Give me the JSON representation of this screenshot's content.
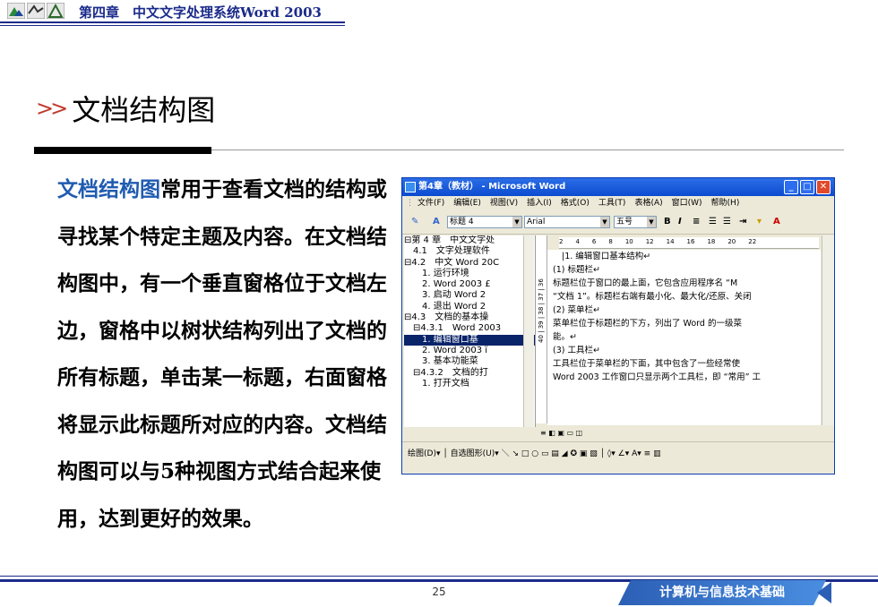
{
  "header": {
    "chapter": "第四章　中文文字处理系统Word 2003"
  },
  "slide": {
    "title": "文档结构图",
    "body_highlight": "文档结构图",
    "body_rest": "常用于查看文档的结构或寻找某个特定主题及内容。在文档结构图中，有一个垂直窗格位于文档左边，窗格中以树状结构列出了文档的所有标题，单击某一标题，右面窗格将显示此标题所对应的内容。文档结构图可以与5种视图方式结合起来使用，达到更好的效果。"
  },
  "window": {
    "title": "第4章（教材） - Microsoft Word",
    "menu": [
      "文件(F)",
      "编辑(E)",
      "视图(V)",
      "插入(I)",
      "格式(O)",
      "工具(T)",
      "表格(A)",
      "窗口(W)",
      "帮助(H)"
    ],
    "style_combo": "标题 4",
    "font_combo": "Arial",
    "size_combo": "五号",
    "map_items": [
      {
        "text": "⊟第 4 章　中文文字处",
        "selected": false
      },
      {
        "text": "　4.1　文字处理软件",
        "selected": false
      },
      {
        "text": "⊟4.2　中文 Word 20C",
        "selected": false
      },
      {
        "text": "　　1. 运行环境",
        "selected": false
      },
      {
        "text": "　　2. Word 2003 £",
        "selected": false
      },
      {
        "text": "　　3. 启动 Word 2",
        "selected": false
      },
      {
        "text": "　　4. 退出 Word 2",
        "selected": false
      },
      {
        "text": "⊟4.3　文档的基本操",
        "selected": false
      },
      {
        "text": "　⊟4.3.1　Word 2003",
        "selected": false
      },
      {
        "text": "　　1. 编辑窗口基",
        "selected": true
      },
      {
        "text": "　　2. Word 2003 ï",
        "selected": false
      },
      {
        "text": "　　3. 基本功能菜",
        "selected": false
      },
      {
        "text": "　⊟4.3.2　文档的打",
        "selected": false
      },
      {
        "text": "　　1. 打开文档",
        "selected": false
      }
    ],
    "ruler_marks": "2　　4　　6　　8　　10　　12　　14　　16　　18　　20　　22",
    "vruler_marks": "40 | 39 | 38 | 37 | 36",
    "doc_lines": [
      "|1. 编辑窗口基本结构↵",
      "(1) 标题栏↵",
      "标题栏位于窗口的最上面，它包含应用程序名 “M",
      "“文档 1”。标题栏右端有最小化、最大化/还原、关闭",
      "(2) 菜单栏↵",
      "菜单栏位于标题栏的下方，列出了 Word 的一级菜",
      "能。↵",
      "(3) 工具栏↵",
      "工具栏位于菜单栏的下面，其中包含了一些经常使",
      "Word 2003 工作窗口只显示两个工具栏，即 “常用” 工"
    ],
    "draw_bar": "绘图(D)▾ │ 自选图形(U)▾ ＼ ↘ □ ○ ▭ ▤ ◢ ✪ ▣ ▧ │ ◊▾ ∠▾ A▾ ≡ ▥",
    "controls": {
      "minimize": "_",
      "restore": "□",
      "close": "✕"
    }
  },
  "footer": {
    "page_number": "25",
    "brand": "计算机与信息技术基础"
  },
  "colors": {
    "title_bar": "#0c4bd0",
    "highlight": "#1f5bb0",
    "header_text": "#1a2a8a",
    "brand": "#2b5fb5",
    "selection": "#0a246a"
  }
}
